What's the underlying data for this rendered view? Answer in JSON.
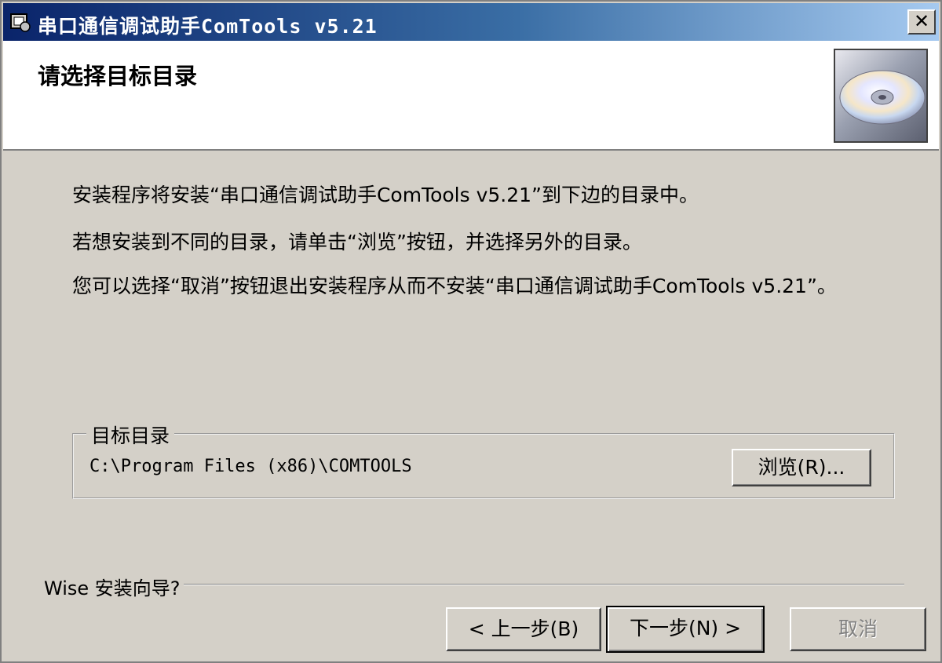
{
  "window": {
    "title": "串口通信调试助手ComTools v5.21",
    "close_glyph": "✕"
  },
  "header": {
    "title": "请选择目标目录",
    "image_icon": "cd-disc-icon"
  },
  "body": {
    "para1": "安装程序将安装“串口通信调试助手ComTools v5.21”到下边的目录中。",
    "para2": "若想安装到不同的目录，请单击“浏览”按钮，并选择另外的目录。",
    "para3": "您可以选择“取消”按钮退出安装程序从而不安装“串口通信调试助手ComTools v5.21”。"
  },
  "destination": {
    "legend": "目标目录",
    "path": "C:\\Program Files (x86)\\COMTOOLS",
    "browse_label": "浏览(R)..."
  },
  "footer": {
    "wizard_label": "Wise 安装向导?",
    "back_label": "< 上一步(B)",
    "next_label": "下一步(N) >",
    "cancel_label": "取消",
    "cancel_enabled": false
  },
  "colors": {
    "titlebar_start": "#0a246a",
    "titlebar_end": "#a6caf0",
    "face": "#d4d0c8"
  }
}
